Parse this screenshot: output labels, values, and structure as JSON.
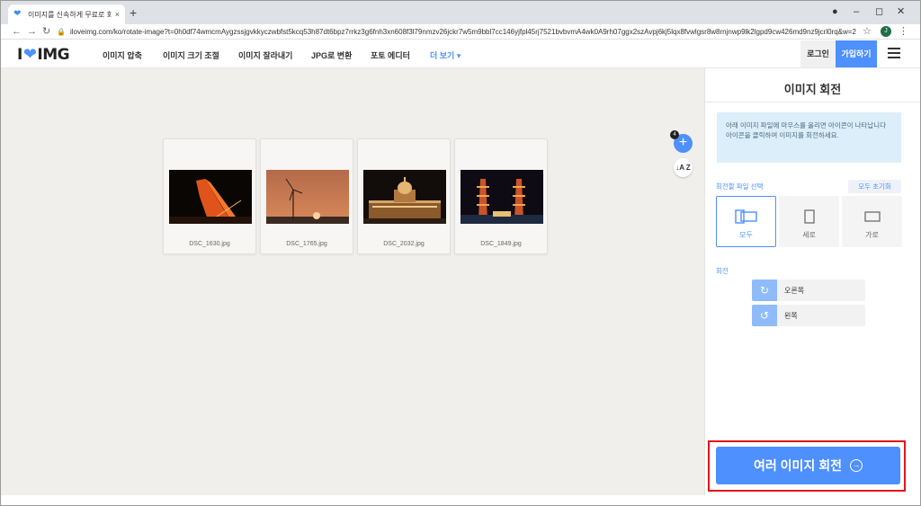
{
  "browser": {
    "tab_title": "이미지를 신속하게 무료로 회전하",
    "tab_close": "×",
    "new_tab": "+",
    "url": "iloveimg.com/ko/rotate-image?t=0h0df74wmcmAygzssjgvkkyczwbfst5kcq53h87dt6bpz7rrkz3g6fnh3xn608f3l79nmzv26jckr7w5m9bbl7cc146yjfpl45rj7521bvbvmA4wk0A9rh07ggx2szAvpj6kj5lqx8fvwlgsr8w8rnjnwp9lk2lgpd9cw426md9nz9jcrl0rq&w=2",
    "profile_initial": "J",
    "controls": {
      "minimize": "–",
      "maximize": "◻",
      "close": "✕",
      "back": "←",
      "forward": "→",
      "reload": "↻",
      "star": "☆",
      "kebab": "⋮",
      "lock": "🔒"
    }
  },
  "site": {
    "logo_left": "I",
    "logo_right": "IMG",
    "menu": [
      "이미지 압축",
      "이미지 크기 조절",
      "이미지 잘라내기",
      "JPG로 변환",
      "포토 에디터",
      "더 보기 ▾"
    ],
    "login": "로그인",
    "signup": "가입하기"
  },
  "workspace": {
    "file_count": "4",
    "add_icon": "+",
    "sort_icon": "↓A Z",
    "files": [
      {
        "name": "DSC_1630.jpg"
      },
      {
        "name": "DSC_1765.jpg"
      },
      {
        "name": "DSC_2032.jpg"
      },
      {
        "name": "DSC_1849.jpg"
      }
    ]
  },
  "panel": {
    "title": "이미지 회전",
    "info": "아래 이미지 파일에 마우스를 올리면 아이콘이 나타납니다 아이콘을 클릭하여 이미지를 회전하세요.",
    "select_label": "회전할 파일 선택",
    "reset": "모두 초기화",
    "orientation": [
      {
        "label": "모두",
        "active": true
      },
      {
        "label": "세로",
        "active": false
      },
      {
        "label": "가로",
        "active": false
      }
    ],
    "rotate_label": "회전",
    "rotate_right": "오른쪽",
    "rotate_left": "왼쪽",
    "rotate_right_icon": "↻",
    "rotate_left_icon": "↺",
    "primary": "여러 이미지 회전",
    "primary_icon": "→"
  },
  "colors": {
    "accent": "#4d90fe",
    "highlight": "#e3141b",
    "workspace_bg": "#f1efec",
    "info_bg": "#dceef9"
  }
}
